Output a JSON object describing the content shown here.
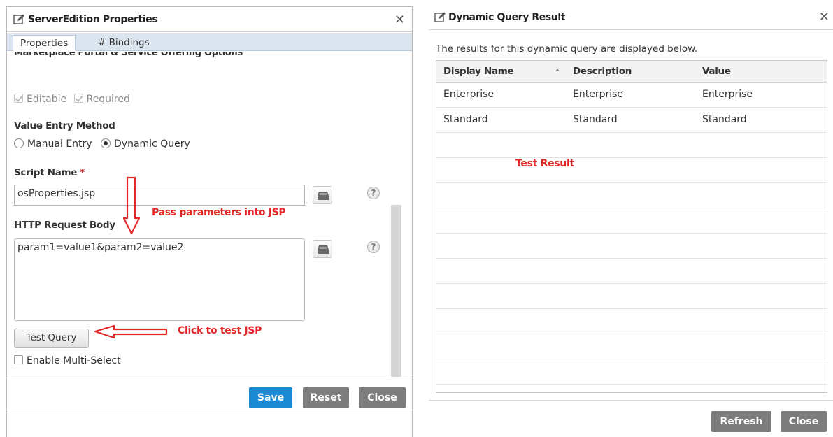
{
  "left_dialog": {
    "title": "ServerEdition Properties",
    "tabs": [
      "Properties",
      "# Bindings"
    ],
    "section_heading_cut": "Marketplace Portal & Service Offering Options",
    "editable_label": "Editable",
    "required_label": "Required",
    "value_entry_label": "Value Entry Method",
    "manual_entry_label": "Manual Entry",
    "dynamic_query_label": "Dynamic Query",
    "selected_method": "Dynamic Query",
    "script_name_label": "Script Name",
    "required_marker": "*",
    "script_name_value": "osProperties.jsp",
    "http_body_label": "HTTP Request Body",
    "http_body_value": "param1=value1&param2=value2",
    "test_query_label": "Test Query",
    "multi_select_label": "Enable Multi-Select",
    "save_label": "Save",
    "reset_label": "Reset",
    "close_label": "Close",
    "help_glyph": "?"
  },
  "annotations": {
    "pass_params": "Pass parameters into JSP",
    "click_test": "Click to test JSP",
    "test_result": "Test Result",
    "color": "#e02828"
  },
  "right_dialog": {
    "title": "Dynamic Query Result",
    "subtitle": "The results for this dynamic query are displayed below.",
    "columns": [
      "Display Name",
      "Description",
      "Value"
    ],
    "rows": [
      [
        "Enterprise",
        "Enterprise",
        "Enterprise"
      ],
      [
        "Standard",
        "Standard",
        "Standard"
      ]
    ],
    "refresh_label": "Refresh",
    "close_label": "Close"
  },
  "colors": {
    "primary_button": "#1a8ad4",
    "secondary_button": "#7d7d7d",
    "tab_bar": "#dbe6f0"
  }
}
